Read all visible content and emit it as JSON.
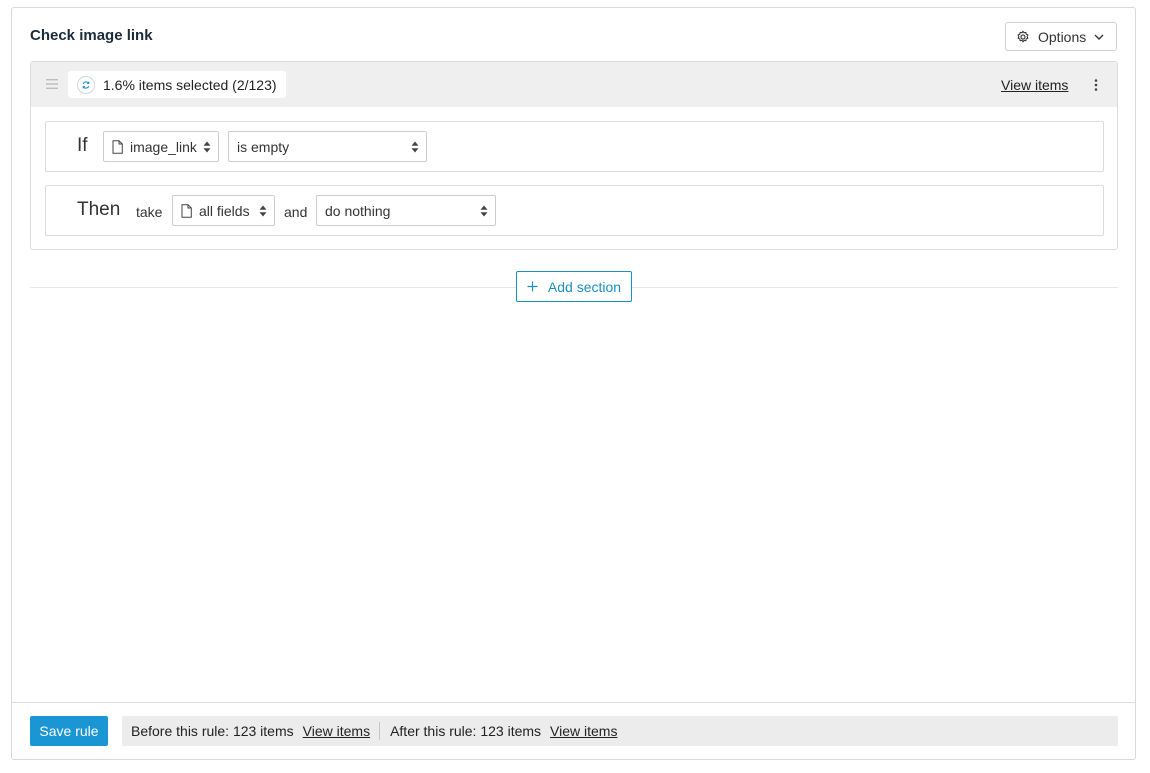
{
  "panel": {
    "title": "Check image link",
    "options_label": "Options"
  },
  "section": {
    "selection_text": "1.6% items selected (2/123)",
    "view_items_label": "View items",
    "if_row": {
      "keyword": "If",
      "field_select": "image_link",
      "condition_select": "is empty"
    },
    "then_row": {
      "keyword": "Then",
      "take_label": "take",
      "fields_select": "all fields",
      "and_label": "and",
      "action_select": "do nothing"
    }
  },
  "add_section_label": "Add section",
  "footer": {
    "save_label": "Save rule",
    "before_text": "Before this rule: 123 items",
    "before_link": "View items",
    "after_text": "After this rule: 123 items",
    "after_link": "View items"
  },
  "colors": {
    "accent": "#1a96d4",
    "header_bg": "#efefef"
  },
  "icons": {
    "options": "gear-icon",
    "options_chevron": "chevron-down-icon",
    "drag": "drag-handle-icon",
    "selection": "refresh-icon",
    "menu": "kebab-menu-icon",
    "field": "document-icon",
    "select_arrows": "sort-arrows-icon",
    "add": "plus-icon"
  }
}
